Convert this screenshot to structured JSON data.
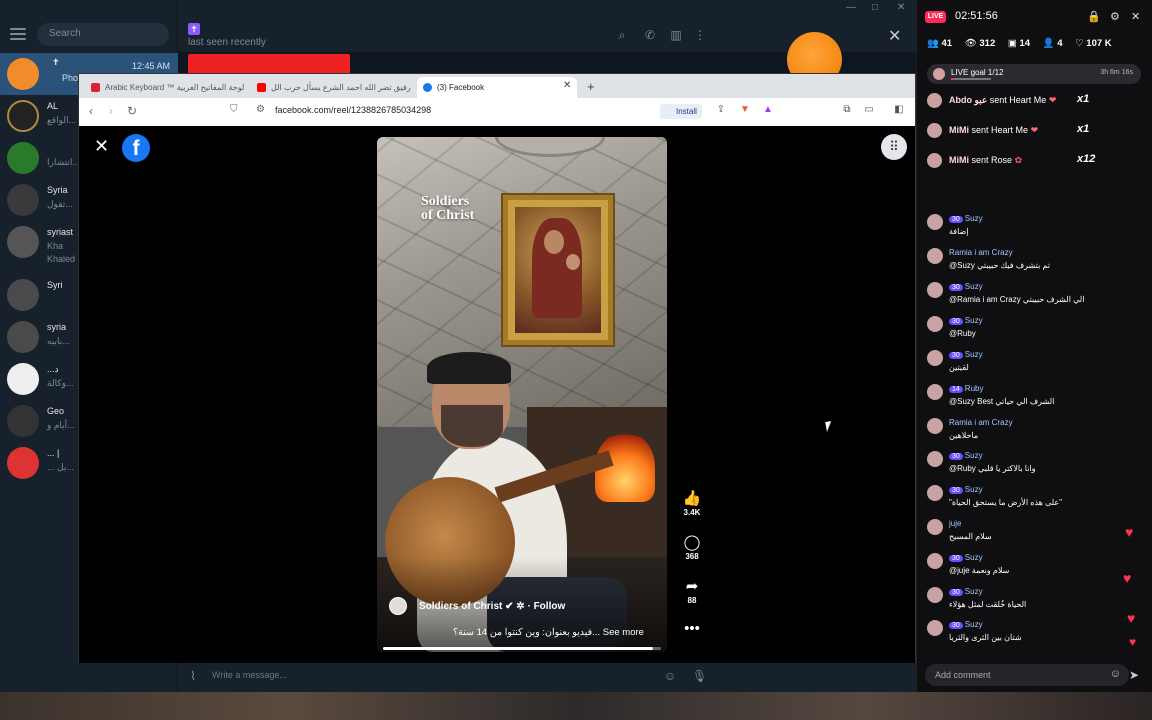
{
  "telegram": {
    "search_placeholder": "Search",
    "last_seen": "last seen recently",
    "compose_placeholder": "Write a message...",
    "chats": [
      {
        "name": "",
        "preview": "Pho",
        "time": "12:45 AM",
        "color": "#f08c2c"
      },
      {
        "name": "AL",
        "preview": "الواقع...",
        "color": "#222"
      },
      {
        "name": "",
        "preview": "انتشارا...",
        "color": "#2b7a2b"
      },
      {
        "name": "Syria",
        "preview": "تقول...",
        "color": "#444"
      },
      {
        "name": "syriast",
        "preview": "Kha",
        "preview2": "Khaled",
        "color": "#555"
      },
      {
        "name": "Syri",
        "preview": "",
        "color": "#444"
      },
      {
        "name": "syria",
        "preview": "بابيه...",
        "color": "#444"
      },
      {
        "name": "...د",
        "preview": "وكالة...",
        "color": "#eee"
      },
      {
        "name": "Geo",
        "preview": "أيام و...",
        "color": "#333"
      },
      {
        "name": "... |",
        "preview": "... بل...",
        "color": "#d33"
      }
    ]
  },
  "browser": {
    "tabs": [
      {
        "label": "Arabic Keyboard ™ لوحة المفاتيح العربية",
        "color": "#d23"
      },
      {
        "label": "رفيق تضر الله احمد الشرع يسأل حرب الل...",
        "color": "#f00"
      },
      {
        "label": "(3) Facebook",
        "color": "#1877f2"
      }
    ],
    "url": "facebook.com/reel/1238826785034298",
    "install_label": "Install"
  },
  "reel": {
    "watermark_line1": "Soldiers",
    "watermark_line2": "of Christ",
    "page_name": "Soldiers of Christ",
    "follow_label": "· Follow",
    "caption": "فيديو بعنوان: وين كنتوا من 14 سنة؟... See more",
    "likes": "3.4K",
    "comments": "368",
    "shares": "88",
    "progress": 0.97
  },
  "live": {
    "badge": "LIVE",
    "time": "02:51:56",
    "stats": {
      "viewers": "41",
      "views": "312",
      "shares": "14",
      "new_follows": "4",
      "likes": "107 K"
    },
    "goal_label": "LIVE goal 1/12",
    "goal_remaining": "3h 6m 16s",
    "goal_progress": 0.08,
    "gifts": [
      {
        "user": "Abdo عبو",
        "action": "sent Heart Me",
        "count": "x1"
      },
      {
        "user": "MiMi",
        "action": "sent Heart Me",
        "count": "x1"
      },
      {
        "user": "MiMi",
        "action": "sent Rose",
        "count": "x12"
      }
    ],
    "comments": [
      {
        "name": "Suzy",
        "level": "30",
        "text": "إضافة"
      },
      {
        "name": "Ramia i am Crazy",
        "level": "",
        "text": "@Suzy تم بتشرف فيك حبيبتي"
      },
      {
        "name": "Suzy",
        "level": "30",
        "text": "@Ramia i am Crazy الي الشرف حبيبتي"
      },
      {
        "name": "Suzy",
        "level": "30",
        "text": "@Ruby"
      },
      {
        "name": "Suzy",
        "level": "30",
        "text": "لقيتين"
      },
      {
        "name": "Ruby",
        "level": "14",
        "text": "@Suzy Best الشرف الي حياتي"
      },
      {
        "name": "Ramia i am Crazy",
        "level": "",
        "text": "ماحلاهين"
      },
      {
        "name": "Suzy",
        "level": "30",
        "text": "@Ruby وانا بالاكتر يا قلبي"
      },
      {
        "name": "Suzy",
        "level": "30",
        "text": "\"على هذه الأرض ما يستحق الحياة\""
      },
      {
        "name": "juje",
        "level": "",
        "text": "سلام المسيح"
      },
      {
        "name": "Suzy",
        "level": "30",
        "text": "@juje سلام ونعمة"
      },
      {
        "name": "Suzy",
        "level": "30",
        "text": "الحياة خُلقت لمثل هؤلاء"
      },
      {
        "name": "Suzy",
        "level": "30",
        "text": "شتان بين الثرى والثريا"
      }
    ],
    "add_comment_placeholder": "Add comment"
  }
}
